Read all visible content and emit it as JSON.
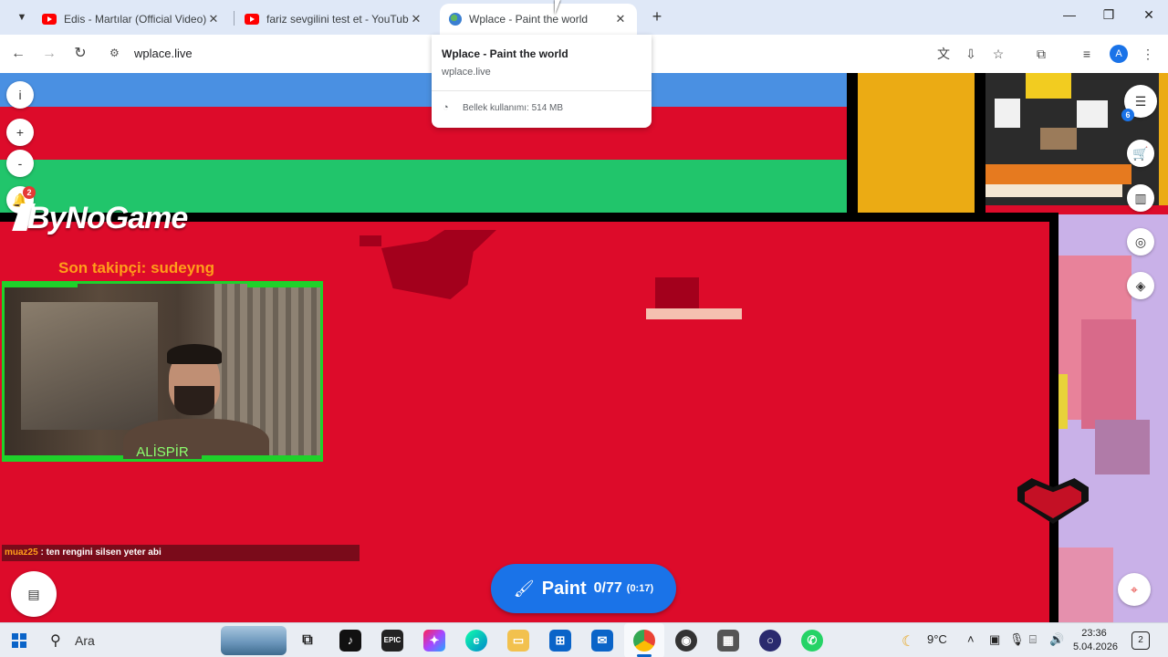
{
  "browser": {
    "tabs": [
      {
        "title": "Edis - Martılar (Official Video) -",
        "favicon": "youtube-icon"
      },
      {
        "title": "fariz sevgilini test et - YouTube",
        "favicon": "youtube-icon"
      },
      {
        "title": "Wplace - Paint the world",
        "favicon": "globe-icon",
        "active": true
      }
    ],
    "tab_close": "✕",
    "new_tab": "+",
    "url": "wplace.live",
    "profile_initial": "A",
    "window_controls": {
      "minimize": "—",
      "maximize": "❐",
      "close": "✕"
    }
  },
  "hover_card": {
    "title": "Wplace - Paint the world",
    "url": "wplace.live",
    "memory": "Bellek kullanımı: 514 MB"
  },
  "map_controls": {
    "info": "i",
    "zoom_in": "+",
    "zoom_out": "-",
    "notification_count": "2",
    "droplets_count": "6"
  },
  "overlay": {
    "logo": "ByNoGame",
    "last_follower": "Son takipçi: sudeyng",
    "webcam_name": "ALİSPİR",
    "chat": {
      "user": "muaz25",
      "message": " : ten rengini silsen yeter abi"
    }
  },
  "paint_button": {
    "label": "Paint",
    "count": "0/77",
    "timer": "(0:17)"
  },
  "taskbar": {
    "search_label": "Ara",
    "weather": "9°C",
    "time": "23:36",
    "date": "5.04.2026",
    "notifications": "2"
  },
  "colors": {
    "canvas_red": "#dd0b2a",
    "blue_band": "#4a90e2",
    "green_band": "#21c56b",
    "paint_blue": "#1a73e8",
    "overlay_green": "#1fd12a",
    "follower_orange": "#ff9e1a"
  }
}
